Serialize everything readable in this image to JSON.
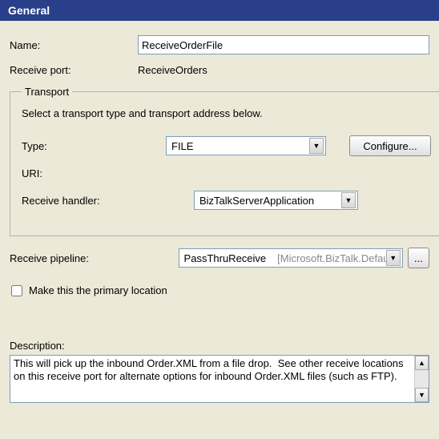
{
  "header": {
    "title": "General"
  },
  "name": {
    "label": "Name:",
    "value": "ReceiveOrderFile"
  },
  "receive_port": {
    "label": "Receive port:",
    "value": "ReceiveOrders"
  },
  "transport": {
    "legend": "Transport",
    "instruction": "Select a transport type and transport address below.",
    "type_label": "Type:",
    "type_value": "FILE",
    "configure_label": "Configure...",
    "uri_label": "URI:",
    "handler_label": "Receive handler:",
    "handler_value": "BizTalkServerApplication"
  },
  "pipeline": {
    "label": "Receive pipeline:",
    "value": "PassThruReceive",
    "detail": "[Microsoft.BizTalk.Defau"
  },
  "primary": {
    "label": "Make this the primary location",
    "checked": false
  },
  "description": {
    "label": "Description:",
    "value": "This will pick up the inbound Order.XML from a file drop.  See other receive locations on this receive port for alternate options for inbound Order.XML files (such as FTP)."
  },
  "ellipsis": "..."
}
